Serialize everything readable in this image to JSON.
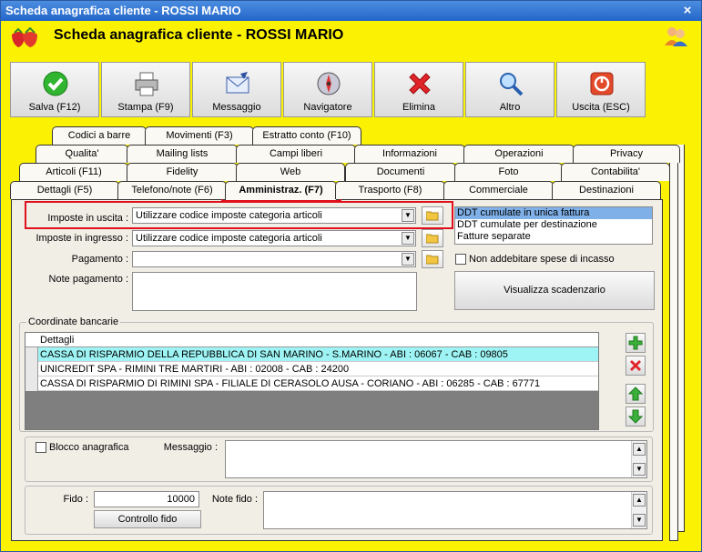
{
  "window": {
    "title": "Scheda anagrafica cliente - ROSSI MARIO",
    "close": "×"
  },
  "header": {
    "title": "Scheda anagrafica cliente - ROSSI MARIO"
  },
  "toolbar": [
    {
      "label": "Salva (F12)",
      "icon": "check-icon"
    },
    {
      "label": "Stampa (F9)",
      "icon": "printer-icon"
    },
    {
      "label": "Messaggio",
      "icon": "envelope-icon"
    },
    {
      "label": "Navigatore",
      "icon": "compass-icon"
    },
    {
      "label": "Elimina",
      "icon": "delete-x-icon"
    },
    {
      "label": "Altro",
      "icon": "magnifier-icon"
    },
    {
      "label": "Uscita (ESC)",
      "icon": "exit-icon"
    }
  ],
  "tabs": {
    "row1": [
      "Codici a barre",
      "Movimenti (F3)",
      "Estratto conto (F10)"
    ],
    "row2": [
      "Qualita'",
      "Mailing lists",
      "Campi liberi",
      "Informazioni",
      "Operazioni",
      "Privacy"
    ],
    "row3": [
      "Articoli (F11)",
      "Fidelity",
      "Web",
      "Documenti",
      "Foto",
      "Contabilita'"
    ],
    "row4": [
      "Dettagli (F5)",
      "Telefono/note (F6)",
      "Amministraz. (F7)",
      "Trasporto (F8)",
      "Commerciale",
      "Destinazioni"
    ]
  },
  "form": {
    "imposte_uscita_label": "Imposte in uscita :",
    "imposte_uscita_value": "Utilizzare codice imposte categoria articoli",
    "imposte_ingresso_label": "Imposte in ingresso :",
    "imposte_ingresso_value": "Utilizzare codice imposte categoria articoli",
    "pagamento_label": "Pagamento :",
    "pagamento_value": "",
    "note_pagamento_label": "Note pagamento :",
    "fatturazione_options": [
      "DDT cumulate in unica fattura",
      "DDT cumulate per destinazione",
      "Fatture separate"
    ],
    "fatturazione_selected": 0,
    "non_addebitare_label": "Non addebitare spese di incasso",
    "visualizza_scadenzario": "Visualizza scadenzario",
    "coordinate_bancarie": "Coordinate bancarie",
    "grid_header": "Dettagli",
    "grid_rows": [
      "CASSA DI RISPARMIO DELLA REPUBBLICA DI SAN MARINO - S.MARINO - ABI : 06067 - CAB : 09805",
      "UNICREDIT SPA - RIMINI TRE MARTIRI - ABI : 02008 - CAB : 24200",
      "CASSA DI RISPARMIO DI RIMINI SPA - FILIALE DI CERASOLO AUSA - CORIANO - ABI : 06285 - CAB : 67771"
    ],
    "blocco_label": "Blocco anagrafica",
    "messaggio_label": "Messaggio :",
    "fido_label": "Fido :",
    "fido_value": "10000",
    "note_fido_label": "Note fido :",
    "controllo_fido": "Controllo fido"
  }
}
